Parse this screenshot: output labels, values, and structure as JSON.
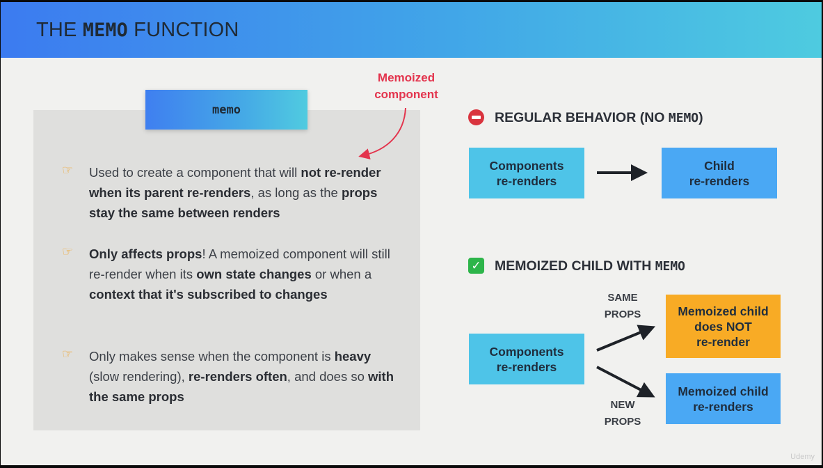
{
  "header": {
    "title_prefix": "THE ",
    "title_code": "MEMO",
    "title_suffix": " FUNCTION"
  },
  "memo_tab": "memo",
  "annotation": {
    "line1": "Memoized",
    "line2": "component"
  },
  "bullets": [
    {
      "icon": "pointing-hand-icon",
      "parts": [
        {
          "t": "Used to create a component that will ",
          "b": false
        },
        {
          "t": "not re-render when its parent re-renders",
          "b": true
        },
        {
          "t": ", as long as the ",
          "b": false
        },
        {
          "t": "props stay the same between renders",
          "b": true
        }
      ]
    },
    {
      "icon": "pointing-hand-icon",
      "parts": [
        {
          "t": "Only affects props",
          "b": true
        },
        {
          "t": "! A memoized component will still re-render when its ",
          "b": false
        },
        {
          "t": "own state changes",
          "b": true
        },
        {
          "t": " or when a ",
          "b": false
        },
        {
          "t": "context that it's subscribed to changes",
          "b": true
        }
      ]
    },
    {
      "icon": "pointing-hand-icon",
      "parts": [
        {
          "t": "Only makes sense when the component is ",
          "b": false
        },
        {
          "t": "heavy",
          "b": true
        },
        {
          "t": " (slow rendering), ",
          "b": false
        },
        {
          "t": "re-renders often",
          "b": true
        },
        {
          "t": ", and does so ",
          "b": false
        },
        {
          "t": "with the same props",
          "b": true
        }
      ]
    }
  ],
  "regular": {
    "title_prefix": "REGULAR BEHAVIOR (NO ",
    "title_code": "MEMO",
    "title_suffix": ")",
    "icon": "no-entry-icon",
    "source_box": {
      "line1": "Components",
      "line2": "re-renders"
    },
    "target_box": {
      "line1": "Child",
      "line2": "re-renders"
    }
  },
  "memoized": {
    "title_prefix": "MEMOIZED CHILD WITH ",
    "title_code": "MEMO",
    "icon": "check-mark-icon",
    "source_box": {
      "line1": "Components",
      "line2": "re-renders"
    },
    "same_label": {
      "line1": "SAME",
      "line2": "PROPS"
    },
    "new_label": {
      "line1": "NEW",
      "line2": "PROPS"
    },
    "same_box": {
      "line1": "Memoized child",
      "line2a": "does ",
      "line2b": "NOT",
      "line3": "re-render"
    },
    "new_box": {
      "line1": "Memoized child",
      "line2": "re-renders"
    }
  },
  "colors": {
    "accent_red": "#e3344d",
    "box_cyan": "#4ec4e8",
    "box_blue": "#4aa8f4",
    "box_orange": "#f8ab25"
  },
  "watermark": "Udemy"
}
